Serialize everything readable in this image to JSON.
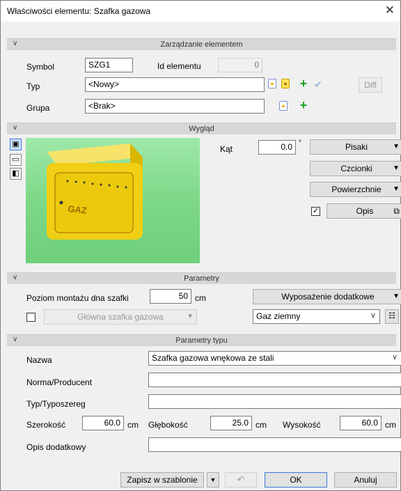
{
  "window": {
    "title": "Właściwości elementu: Szafka gazowa",
    "close_glyph": "✕"
  },
  "sections": {
    "management": "Zarządzanie elementem",
    "appearance": "Wygląd",
    "parameters": "Parametry",
    "type_parameters": "Parametry typu"
  },
  "management": {
    "symbol_label": "Symbol",
    "symbol_value": "SZG1",
    "id_label": "Id elementu",
    "id_value": "0",
    "type_label": "Typ",
    "type_value": "<Nowy>",
    "group_label": "Grupa",
    "group_value": "<Brak>",
    "diff_label": "Diff"
  },
  "appearance": {
    "angle_label": "Kąt",
    "angle_value": "0.0",
    "angle_unit": "°",
    "pens_label": "Pisaki",
    "fonts_label": "Czcionki",
    "surfaces_label": "Powierzchnie",
    "description_label": "Opis",
    "description_checked": true,
    "preview_text": "GAZ"
  },
  "parameters": {
    "mount_label": "Poziom montażu dna szafki",
    "mount_value": "50",
    "mount_unit": "cm",
    "extra_equipment_label": "Wyposażenie dodatkowe",
    "main_cabinet_label": "Główna szafka gazowa",
    "gas_type_value": "Gaz ziemny"
  },
  "type_parameters": {
    "name_label": "Nazwa",
    "name_value": "Szafka gazowa wnękowa ze stali",
    "norm_label": "Norma/Producent",
    "norm_value": "",
    "series_label": "Typ/Typoszereg",
    "series_value": "",
    "width_label": "Szerokość",
    "width_value": "60.0",
    "depth_label": "Głębokość",
    "depth_value": "25.0",
    "height_label": "Wysokość",
    "height_value": "60.0",
    "unit": "cm",
    "extra_desc_label": "Opis dodatkowy",
    "extra_desc_value": ""
  },
  "footer": {
    "save_template_label": "Zapisz w szablonie",
    "ok_label": "OK",
    "cancel_label": "Anuluj"
  },
  "colors": {
    "accent": "#3b78d6",
    "preview_bg": "#86dd92",
    "cabinet": "#f2d21f",
    "plus": "#21a121"
  }
}
